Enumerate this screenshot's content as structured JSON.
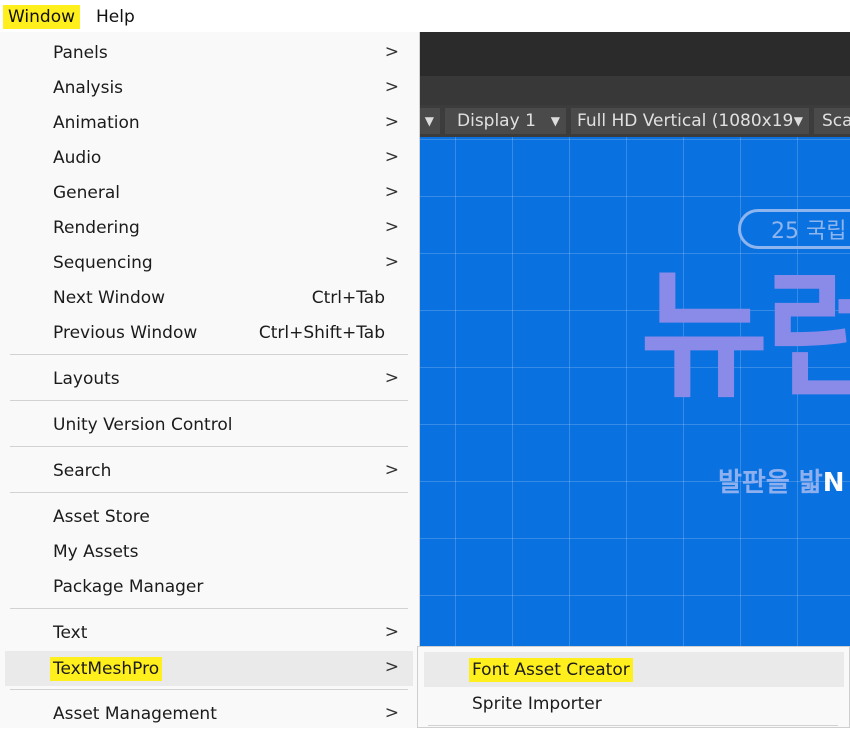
{
  "menubar": {
    "items": [
      "Window",
      "Help"
    ]
  },
  "game_toolbar": {
    "display": "Display 1",
    "resolution": "Full HD Vertical (1080x19",
    "scale": "Sca"
  },
  "game_view": {
    "badge": "25 국립",
    "headline": "뉴런",
    "subline": "발판을 밟",
    "subline_accent": "N"
  },
  "window_menu": {
    "items": [
      {
        "label": "Panels",
        "shortcut": "",
        "submenu": true
      },
      {
        "label": "Analysis",
        "shortcut": "",
        "submenu": true
      },
      {
        "label": "Animation",
        "shortcut": "",
        "submenu": true
      },
      {
        "label": "Audio",
        "shortcut": "",
        "submenu": true
      },
      {
        "label": "General",
        "shortcut": "",
        "submenu": true
      },
      {
        "label": "Rendering",
        "shortcut": "",
        "submenu": true
      },
      {
        "label": "Sequencing",
        "shortcut": "",
        "submenu": true
      },
      {
        "label": "Next Window",
        "shortcut": "Ctrl+Tab",
        "submenu": false
      },
      {
        "label": "Previous Window",
        "shortcut": "Ctrl+Shift+Tab",
        "submenu": false
      },
      {
        "label": "Layouts",
        "shortcut": "",
        "submenu": true
      },
      {
        "label": "Unity Version Control",
        "shortcut": "",
        "submenu": false
      },
      {
        "label": "Search",
        "shortcut": "",
        "submenu": true
      },
      {
        "label": "Asset Store",
        "shortcut": "",
        "submenu": false
      },
      {
        "label": "My Assets",
        "shortcut": "",
        "submenu": false
      },
      {
        "label": "Package Manager",
        "shortcut": "",
        "submenu": false
      },
      {
        "label": "Text",
        "shortcut": "",
        "submenu": true
      },
      {
        "label": "TextMeshPro",
        "shortcut": "",
        "submenu": true
      },
      {
        "label": "Asset Management",
        "shortcut": "",
        "submenu": true
      }
    ]
  },
  "textmeshpro_submenu": {
    "items": [
      "Font Asset Creator",
      "Sprite Importer"
    ]
  },
  "icons": {
    "submenu_arrow": "chevron-right-icon",
    "dropdown_arrow": "caret-down-icon"
  },
  "colors": {
    "highlight": "#ffef1c",
    "game_bg": "#0a72e0",
    "editor_bg": "#2b2b2b"
  }
}
